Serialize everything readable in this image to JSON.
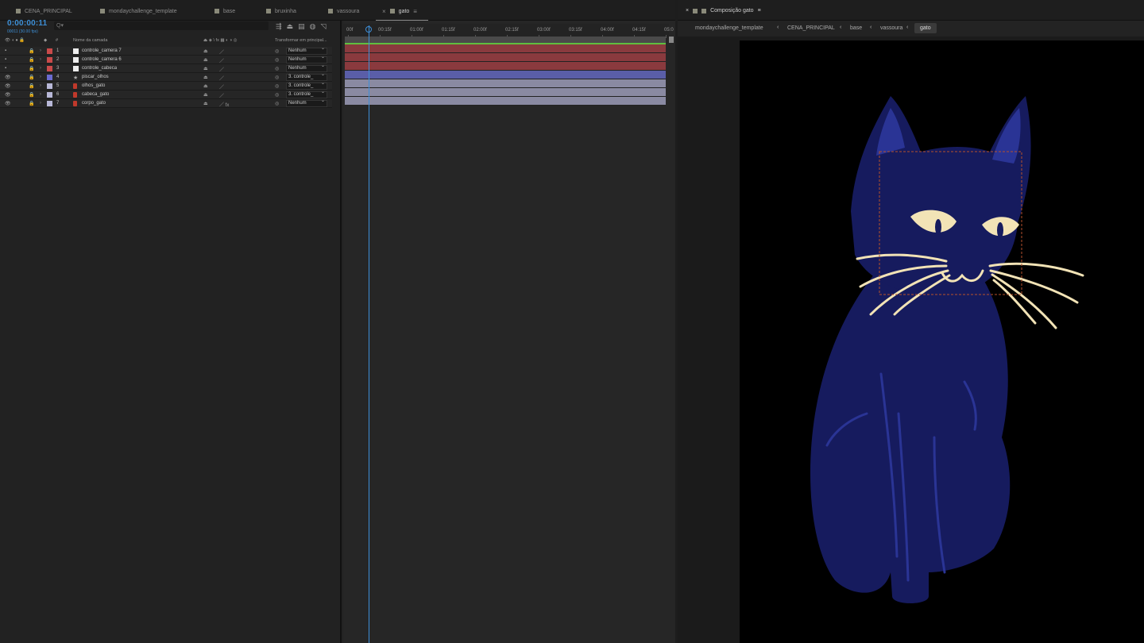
{
  "tabs": [
    {
      "label": "CENA_PRINCIPAL"
    },
    {
      "label": "mondaychallenge_template"
    },
    {
      "label": "base"
    },
    {
      "label": "bruxinha"
    },
    {
      "label": "vassoura"
    },
    {
      "label": "gato"
    }
  ],
  "timeline": {
    "timecode": "0:00:00:11",
    "timecode_sub": "00011 (30.00 fps)",
    "search_placeholder": "Q▾",
    "columns": {
      "name": "Nome da camada",
      "parent": "Transformar em principal..."
    },
    "layers": [
      {
        "num": "1",
        "name": "controle_camera 7",
        "parent": "Nenhum",
        "label_color": "#c94a4a",
        "icon": "white-square",
        "eye": false,
        "fx": false
      },
      {
        "num": "2",
        "name": "controle_camera 6",
        "parent": "Nenhum",
        "label_color": "#c94a4a",
        "icon": "white-square",
        "eye": false,
        "fx": false
      },
      {
        "num": "3",
        "name": "controle_cabeca",
        "parent": "Nenhum",
        "label_color": "#c94a4a",
        "icon": "white-square",
        "eye": false,
        "fx": false
      },
      {
        "num": "4",
        "name": "piscar_olhos",
        "parent": "3. controle_",
        "label_color": "#6b6bd0",
        "icon": "star",
        "eye": true,
        "fx": false
      },
      {
        "num": "5",
        "name": "olhos_gato",
        "parent": "3. controle_",
        "label_color": "#b8b8d8",
        "icon": "ai-file",
        "eye": true,
        "fx": false
      },
      {
        "num": "6",
        "name": "cabeca_gato",
        "parent": "3. controle_",
        "label_color": "#b8b8d8",
        "icon": "ai-file",
        "eye": true,
        "fx": false
      },
      {
        "num": "7",
        "name": "corpo_gato",
        "parent": "Nenhum",
        "label_color": "#b8b8d8",
        "icon": "ai-file",
        "eye": true,
        "fx": true
      }
    ],
    "ruler": [
      "00f",
      "00:15f",
      "01:00f",
      "01:15f",
      "02:00f",
      "02:15f",
      "03:00f",
      "03:15f",
      "04:00f",
      "04:15f",
      "05:0"
    ],
    "track_colors": [
      "#8a3a3e",
      "#8a3a3e",
      "#8a3a3e",
      "#5a5ea8",
      "#8a8aa2",
      "#8a8aa2",
      "#8a8aa2"
    ]
  },
  "composition": {
    "tab_label": "Composição gato",
    "breadcrumbs": [
      "mondaychallenge_template",
      "CENA_PRINCIPAL",
      "base",
      "vassoura",
      "gato"
    ]
  },
  "icons": [
    "eye-icon",
    "lock-icon",
    "search-icon",
    "chevron-right-icon",
    "menu-icon",
    "close-icon"
  ]
}
